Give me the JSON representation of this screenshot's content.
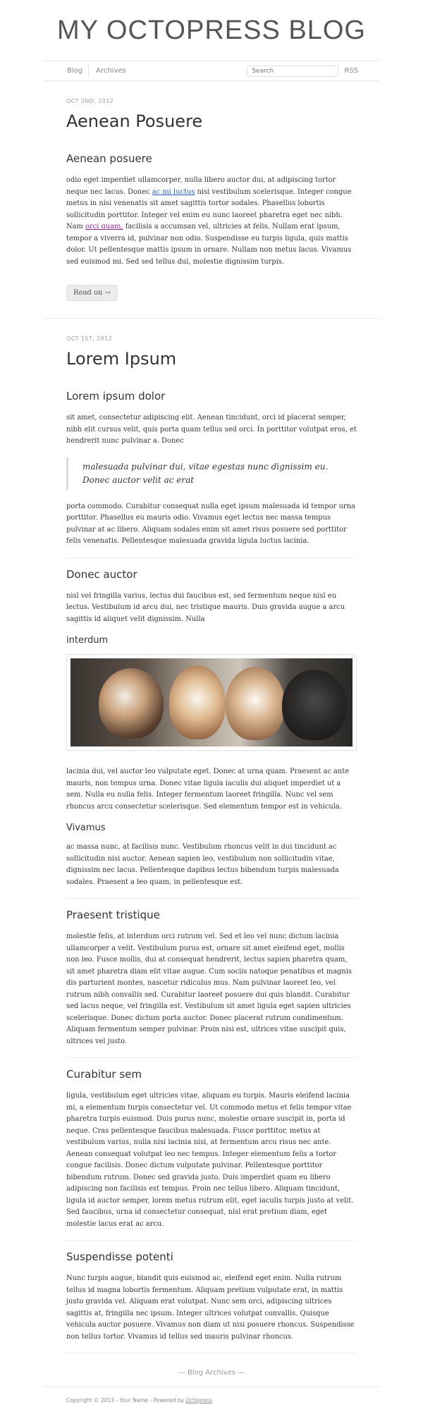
{
  "header": {
    "title": "MY OCTOPRESS BLOG"
  },
  "nav": {
    "blog": "Blog",
    "archives": "Archives",
    "search_placeholder": "Search",
    "rss": "RSS"
  },
  "post1": {
    "date": "OCT 2ND, 2012",
    "title": "Aenean Posuere",
    "heading": "Aenean posuere",
    "p1_a": "odio eget imperdiet ullamcorper, nulla libero auctor dui, at adipiscing tortor neque nec lacus. Donec ",
    "link1": "ac mi luctus",
    "p1_b": " nisi vestibulum scelerisque. Integer congue metus in nisi venenatis sit amet sagittis tortor sodales. Phasellus lobortis sollicitudin porttitor. Integer vel enim eu nunc laoreet pharetra eget nec nibh. Nam ",
    "link2": "orci quam,",
    "p1_c": " facilisis a accumsan vel, ultricies at felis. Nullam erat ipsum, tempor a viverra id, pulvinar non odio. Suspendisse eu turpis ligula, quis mattis dolor. Ut pellentesque mattis ipsum in ornare. Nullam non metus lacus. Vivamus sed euismod mi. Sed sed tellus dui, molestie dignissim turpis.",
    "read_on": "Read on →"
  },
  "post2": {
    "date": "OCT 1ST, 2012",
    "title": "Lorem Ipsum",
    "h_lorem": "Lorem ipsum dolor",
    "p_lorem": "sit amet, consectetur adipiscing elit. Aenean tincidunt, orci id placerat semper, nibh elit cursus velit, quis porta quam tellus sed orci. In porttitor volutpat eros, et hendrerit nunc pulvinar a. Donec",
    "quote": "malesuada pulvinar dui, vitae egestas nunc dignissim eu. Donec auctor velit ac erat",
    "p_porta": "porta commodo. Curabitur consequat nulla eget ipsum malesuada id tempor urna porttitor. Phasellus eu mauris odio. Vivamus eget lectus nec massa tempus pulvinar at ac libero. Aliquam sodales enim sit amet risus posuere sed porttitor felis venenatis. Pellentesque malesuada gravida ligula luctus lacinia.",
    "h_donec": "Donec auctor",
    "p_donec": "nisl vel fringilla varius, lectus dui faucibus est, sed fermentum neque nisl eu lectus. Vestibulum id arcu dui, nec tristique mauris. Duis gravida augue a arcu sagittis id aliquet velit dignissim. Nulla",
    "h_interdum": "interdum",
    "p_lacinia": "lacinia dui, vel auctor leo vulputate eget. Donec at urna quam. Praesent ac ante mauris, non tempus urna. Donec vitae ligula iaculis dui aliquet imperdiet ut a sem. Nulla eu nulla felis. Integer fermentum laoreet fringilla. Nunc vel sem rhoncus arcu consectetur scelerisque. Sed elementum tempor est in vehicula.",
    "h_vivamus": "Vivamus",
    "p_vivamus": "ac massa nunc, at facilisis nunc. Vestibulum rhoncus velit in dui tincidunt ac sollicitudin nisi auctor. Aenean sapien leo, vestibulum non sollicitudin vitae, dignissim nec lacus. Pellentesque dapibus lectus bibendum turpis malesuada sodales. Praesent a leo quam, in pellentesque est.",
    "h_praesent": "Praesent tristique",
    "p_praesent": "molestie felis, at interdum orci rutrum vel. Sed et leo vel nunc dictum lacinia ullamcorper a velit. Vestibulum purus est, ornare sit amet eleifend eget, mollis non leo. Fusce mollis, dui at consequat hendrerit, lectus sapien pharetra quam, sit amet pharetra diam elit vitae augue. Cum sociis natoque penatibus et magnis dis parturient montes, nascetur ridiculus mus. Nam pulvinar laoreet leo, vel rutrum nibh convallis sed. Curabitur laoreet posuere dui quis blandit. Curabitur sed lacus neque, vel fringilla est. Vestibulum sit amet ligula eget sapien ultricies scelerisque. Donec dictum porta auctor. Donec placerat rutrum condimentum. Aliquam fermentum semper pulvinar. Proin nisi est, ultrices vitae suscipit quis, ultrices vel justo.",
    "h_curabitur": "Curabitur sem",
    "p_curabitur": "ligula, vestibulum eget ultricies vitae, aliquam eu turpis. Mauris eleifend lacinia mi, a elementum turpis consectetur vel. Ut commodo metus et felis tempor vitae pharetra turpis euismod. Duis purus nunc, molestie ornare suscipit in, porta id neque. Cras pellentesque faucibus malesuada. Fusce porttitor, metus at vestibulum varius, nulla nisi lacinia nisi, at fermentum arcu risus nec ante. Aenean consequat volutpat leo nec tempus. Integer elementum felis a tortor congue facilisis. Donec dictum vulputate pulvinar. Pellentesque porttitor bibendum rutrum. Donec sed gravida justo. Duis imperdiet quam eu libero adipiscing non facilisis est tempus. Proin nec tellus libero. Aliquam tincidunt, ligula id auctor semper, lorem metus rutrum elit, eget iaculis turpis justo at velit. Sed faucibus, urna id consectetur consequat, nisl erat pretium diam, eget molestie lacus erat ac arcu.",
    "h_suspendisse": "Suspendisse potenti",
    "p_suspendisse": "Nunc turpis augue, blandit quis euismod ac, eleifend eget enim. Nulla rutrum tellus id magna lobortis fermentum. Aliquam pretium vulputate erat, in mattis justo gravida vel. Aliquam erat volutpat. Nunc sem orci, adipiscing ultrices sagittis at, fringilla nec ipsum. Integer ultrices volutpat convallis. Quisque vehicula auctor posuere. Vivamus non diam ut nisi posuere rhoncus. Suspendisse non tellus tortor. Vivamus id tellus sed mauris pulvinar rhoncus."
  },
  "archives_link": "— Blog Archives —",
  "footer": {
    "text": "Copyright © 2013 - Your Name - Powered by ",
    "link": "Octopress"
  }
}
